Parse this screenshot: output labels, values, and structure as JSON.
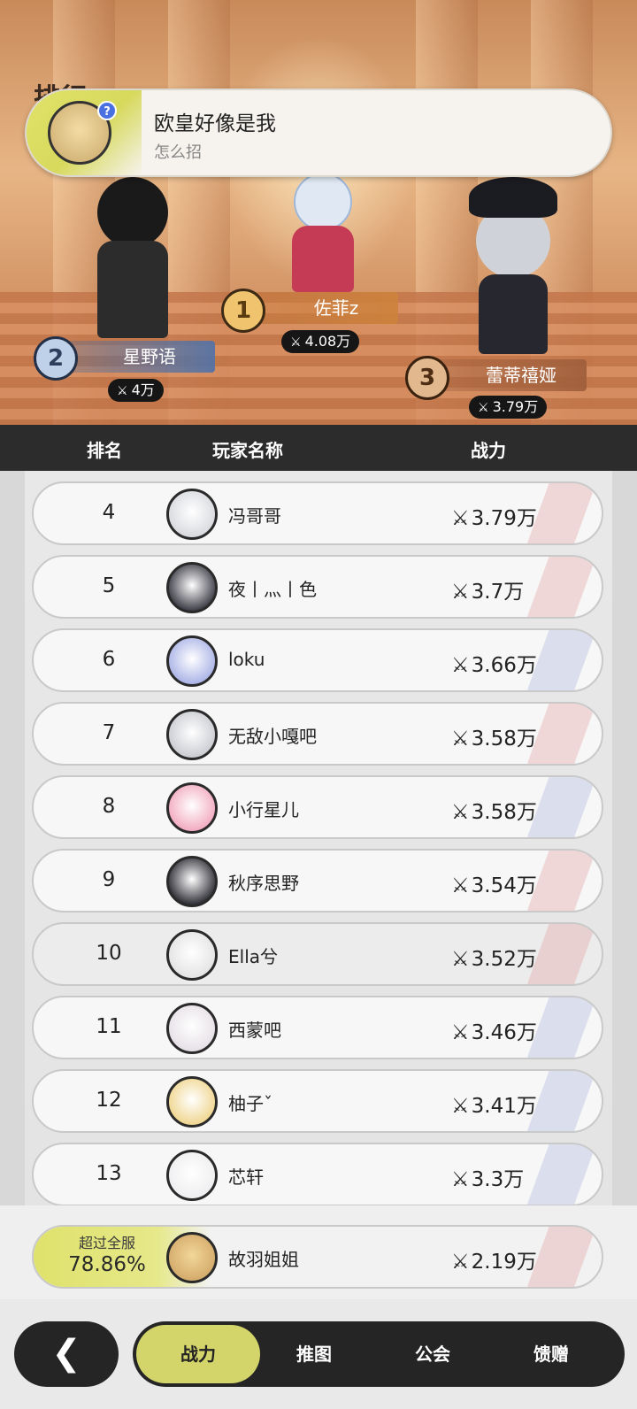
{
  "page": {
    "title_peek": "排行"
  },
  "notice": {
    "title": "欧皇好像是我",
    "subtitle": "怎么招",
    "badge": "?"
  },
  "podium": [
    {
      "rank": "1",
      "name": "佐菲z",
      "power": "4.08万"
    },
    {
      "rank": "2",
      "name": "星野语",
      "power": "4万"
    },
    {
      "rank": "3",
      "name": "蕾蒂禧娅",
      "power": "3.79万"
    }
  ],
  "power_icon": "swords-icon",
  "columns": {
    "rank": "排名",
    "player": "玩家名称",
    "power": "战力"
  },
  "rows": [
    {
      "rank": "4",
      "name": "冯哥哥",
      "power": "3.79万",
      "avatar_color": "#d7d9de",
      "deco": "red"
    },
    {
      "rank": "5",
      "name": "夜丨灬丨色",
      "power": "3.7万",
      "avatar_color": "#3a3a44",
      "deco": "red"
    },
    {
      "rank": "6",
      "name": "loku",
      "power": "3.66万",
      "avatar_color": "#a9b2e6",
      "deco": "blue"
    },
    {
      "rank": "7",
      "name": "无敌小嘎吧",
      "power": "3.58万",
      "avatar_color": "#c9cbd1",
      "deco": "red"
    },
    {
      "rank": "8",
      "name": "小行星儿",
      "power": "3.58万",
      "avatar_color": "#f2a9bf",
      "deco": "blue"
    },
    {
      "rank": "9",
      "name": "秋序思野",
      "power": "3.54万",
      "avatar_color": "#2c2c34",
      "deco": "red"
    },
    {
      "rank": "10",
      "name": "Ella兮",
      "power": "3.52万",
      "avatar_color": "#e3e3e3",
      "deco": "red"
    },
    {
      "rank": "11",
      "name": "西蒙吧",
      "power": "3.46万",
      "avatar_color": "#e6e0e6",
      "deco": "blue"
    },
    {
      "rank": "12",
      "name": "柚子ˇ",
      "power": "3.41万",
      "avatar_color": "#efd58e",
      "deco": "blue"
    },
    {
      "rank": "13",
      "name": "芯轩",
      "power": "3.3万",
      "avatar_color": "#eeeef0",
      "deco": "blue"
    }
  ],
  "self": {
    "label": "超过全服",
    "percent": "78.86%",
    "name": "故羽姐姐",
    "power": "2.19万"
  },
  "nav": {
    "back_icon": "chevron-left-icon",
    "back_glyph": "❮",
    "tabs": [
      {
        "label": "战力",
        "active": true
      },
      {
        "label": "推图",
        "active": false
      },
      {
        "label": "公会",
        "active": false
      },
      {
        "label": "馈赠",
        "active": false
      }
    ]
  },
  "colors": {
    "accent": "#d3d46a",
    "dark": "#252525"
  }
}
